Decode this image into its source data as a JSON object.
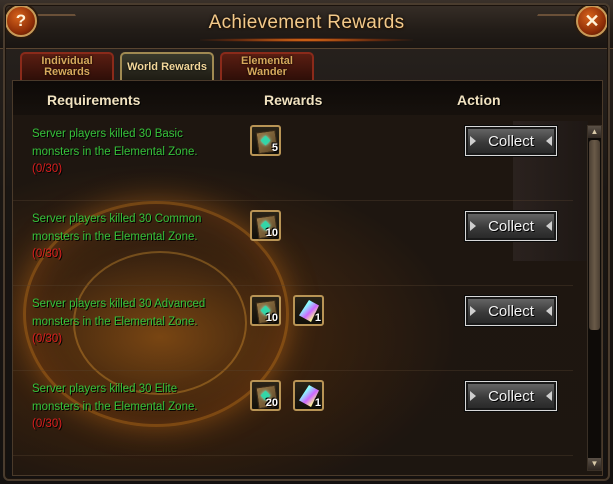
{
  "window": {
    "title": "Achievement Rewards"
  },
  "tabs": [
    {
      "label": "Individual Rewards"
    },
    {
      "label": "World Rewards"
    },
    {
      "label": "Elemental Wander"
    }
  ],
  "columns": {
    "requirements": "Requirements",
    "rewards": "Rewards",
    "action": "Action"
  },
  "rows": [
    {
      "req": "Server players killed 30 Basic monsters in the Elemental Zone.",
      "progress": "(0/30)",
      "rewards": [
        {
          "icon": "tome-icon",
          "count": "5"
        }
      ],
      "action": "Collect"
    },
    {
      "req": "Server players killed 30 Common monsters in the Elemental Zone.",
      "progress": "(0/30)",
      "rewards": [
        {
          "icon": "tome-icon",
          "count": "10"
        }
      ],
      "action": "Collect"
    },
    {
      "req": "Server players killed 30 Advanced monsters in the Elemental Zone.",
      "progress": "(0/30)",
      "rewards": [
        {
          "icon": "tome-icon",
          "count": "10"
        },
        {
          "icon": "crystal-icon",
          "count": "1"
        }
      ],
      "action": "Collect"
    },
    {
      "req": "Server players killed 30 Elite monsters in the Elemental Zone.",
      "progress": "(0/30)",
      "rewards": [
        {
          "icon": "tome-icon",
          "count": "20"
        },
        {
          "icon": "crystal-icon",
          "count": "1"
        }
      ],
      "action": "Collect"
    }
  ],
  "icons": {
    "help": "?",
    "close": "✕",
    "scroll_up": "▲",
    "scroll_down": "▼"
  }
}
